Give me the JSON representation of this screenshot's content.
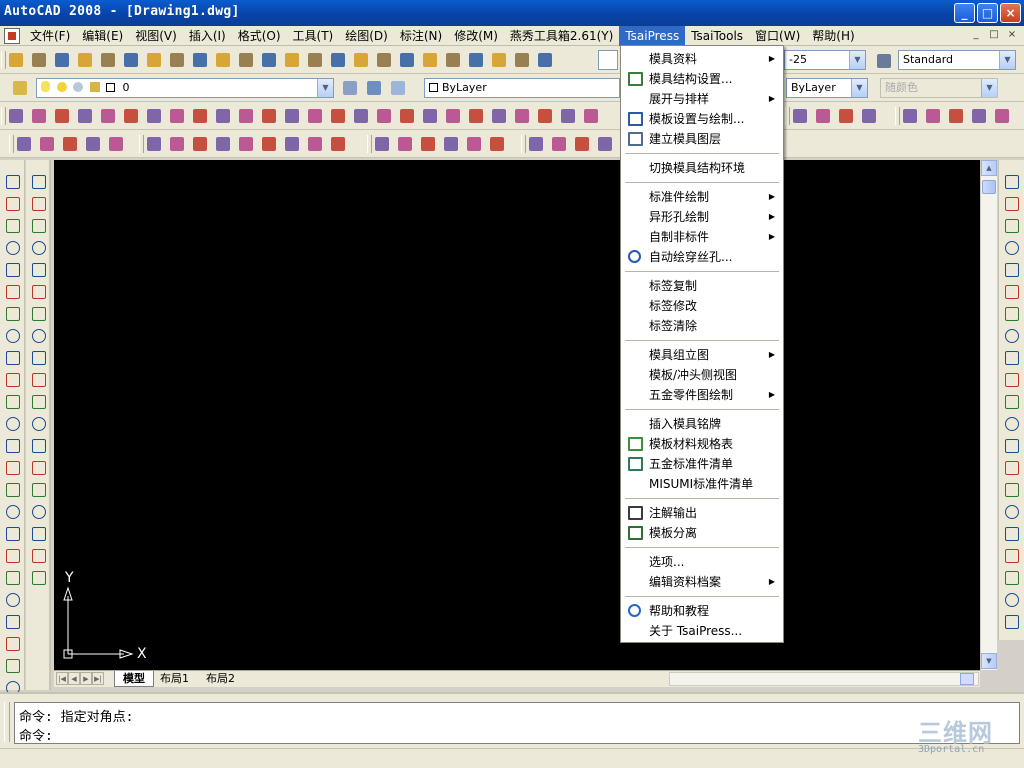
{
  "window": {
    "title": "AutoCAD 2008 - [Drawing1.dwg]",
    "controls": [
      "_",
      "□",
      "×"
    ]
  },
  "menubar": {
    "items": [
      {
        "label": "文件(F)"
      },
      {
        "label": "编辑(E)"
      },
      {
        "label": "视图(V)"
      },
      {
        "label": "插入(I)"
      },
      {
        "label": "格式(O)"
      },
      {
        "label": "工具(T)"
      },
      {
        "label": "绘图(D)"
      },
      {
        "label": "标注(N)"
      },
      {
        "label": "修改(M)"
      },
      {
        "label": "燕秀工具箱2.61(Y)"
      },
      {
        "label": "TsaiPress",
        "active": true
      },
      {
        "label": "TsaiTools"
      },
      {
        "label": "窗口(W)"
      },
      {
        "label": "帮助(H)"
      }
    ],
    "mdi_controls": [
      "_",
      "□",
      "×"
    ]
  },
  "toolbars": {
    "text_style_combo": "Standard",
    "dim_style_combo": "ISO-25",
    "dim_style_combo_visible": "-25",
    "layer_combo": "0",
    "color_combo": "ByLayer",
    "linetype_combo": "ByLayer",
    "plotstyle_combo": "随颜色"
  },
  "tsaipress_menu": {
    "items": [
      {
        "label": "模具资料",
        "submenu": true,
        "icon": ""
      },
      {
        "label": "模具结构设置...",
        "submenu": false,
        "icon": "structure-settings-icon"
      },
      {
        "label": "展开与排样",
        "submenu": true,
        "icon": ""
      },
      {
        "label": "模板设置与绘制...",
        "submenu": false,
        "icon": "template-draw-icon"
      },
      {
        "label": "建立模具图层",
        "submenu": false,
        "icon": "layers-icon"
      },
      {
        "label": "---"
      },
      {
        "label": "切换模具结构环境",
        "submenu": false,
        "icon": ""
      },
      {
        "label": "---"
      },
      {
        "label": "标准件绘制",
        "submenu": true,
        "icon": ""
      },
      {
        "label": "异形孔绘制",
        "submenu": true,
        "icon": ""
      },
      {
        "label": "自制非标件",
        "submenu": true,
        "icon": ""
      },
      {
        "label": "自动绘穿丝孔...",
        "submenu": false,
        "icon": "wire-hole-icon"
      },
      {
        "label": "---"
      },
      {
        "label": "标签复制",
        "submenu": false,
        "icon": ""
      },
      {
        "label": "标签修改",
        "submenu": false,
        "icon": ""
      },
      {
        "label": "标签清除",
        "submenu": false,
        "icon": ""
      },
      {
        "label": "---"
      },
      {
        "label": "模具组立图",
        "submenu": true,
        "icon": ""
      },
      {
        "label": "模板/冲头侧视图",
        "submenu": false,
        "icon": ""
      },
      {
        "label": "五金零件图绘制",
        "submenu": true,
        "icon": ""
      },
      {
        "label": "---"
      },
      {
        "label": "插入模具铭牌",
        "submenu": false,
        "icon": ""
      },
      {
        "label": "模板材料规格表",
        "submenu": false,
        "icon": "material-table-icon"
      },
      {
        "label": "五金标准件清单",
        "submenu": false,
        "icon": "parts-list-icon"
      },
      {
        "label": "MISUMI标准件清单",
        "submenu": false,
        "icon": ""
      },
      {
        "label": "---"
      },
      {
        "label": "注解输出",
        "submenu": false,
        "icon": "note-icon"
      },
      {
        "label": "模板分离",
        "submenu": false,
        "icon": "template-split-icon"
      },
      {
        "label": "---"
      },
      {
        "label": "选项...",
        "submenu": false,
        "icon": ""
      },
      {
        "label": "编辑资料档案",
        "submenu": true,
        "icon": ""
      },
      {
        "label": "---"
      },
      {
        "label": "帮助和教程",
        "submenu": false,
        "icon": "help-icon"
      },
      {
        "label": "关于 TsaiPress...",
        "submenu": false,
        "icon": ""
      }
    ]
  },
  "canvas": {
    "ucs_x": "X",
    "ucs_y": "Y"
  },
  "layout_tabs": [
    {
      "label": "模型",
      "active": true
    },
    {
      "label": "布局1",
      "active": false
    },
    {
      "label": "布局2",
      "active": false
    }
  ],
  "command": {
    "line1": "命令: 指定对角点:",
    "line2": "命令:"
  },
  "watermark": {
    "logo": "三维网",
    "site": "3Dportal.cn"
  },
  "colors": {
    "titlebar": "#0a5ccf",
    "menu_highlight": "#316ac5",
    "canvas": "#000000"
  }
}
